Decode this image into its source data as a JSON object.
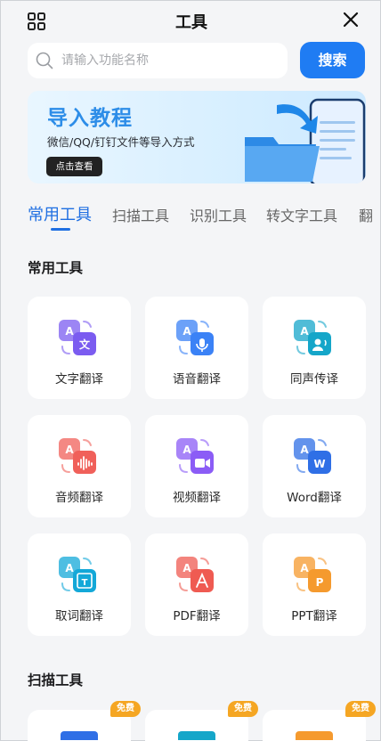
{
  "header": {
    "title": "工具",
    "grid_icon": "grid-icon",
    "close_icon": "close-icon"
  },
  "search": {
    "placeholder": "请输入功能名称",
    "button_label": "搜索"
  },
  "banner": {
    "title": "导入教程",
    "subtitle": "微信/QQ/钉钉文件等导入方式",
    "button_label": "点击查看",
    "page_count": 2,
    "active_page": 1
  },
  "tabs": [
    "常用工具",
    "扫描工具",
    "识别工具",
    "转文字工具",
    "翻"
  ],
  "active_tab": 0,
  "sections": {
    "common": {
      "title": "常用工具",
      "tools": [
        {
          "label": "文字翻译",
          "icon": "text-translate-icon",
          "color": "#7b5cf0"
        },
        {
          "label": "语音翻译",
          "icon": "voice-translate-icon",
          "color": "#3b82f6"
        },
        {
          "label": "同声传译",
          "icon": "simultaneous-interpret-icon",
          "color": "#15a6c9"
        },
        {
          "label": "音频翻译",
          "icon": "audio-translate-icon",
          "color": "#f0605a"
        },
        {
          "label": "视频翻译",
          "icon": "video-translate-icon",
          "color": "#8b5cf6"
        },
        {
          "label": "Word翻译",
          "icon": "word-translate-icon",
          "color": "#2f6fe6"
        },
        {
          "label": "取词翻译",
          "icon": "word-pick-translate-icon",
          "color": "#13a8d8"
        },
        {
          "label": "PDF翻译",
          "icon": "pdf-translate-icon",
          "color": "#ef5b52"
        },
        {
          "label": "PPT翻译",
          "icon": "ppt-translate-icon",
          "color": "#f59a2e"
        }
      ]
    },
    "scan": {
      "title": "扫描工具",
      "badge_label": "免费",
      "items": [
        {
          "color": "#2f6fe6"
        },
        {
          "color": "#15a6c9"
        },
        {
          "color": "#f59a2e"
        }
      ]
    }
  }
}
